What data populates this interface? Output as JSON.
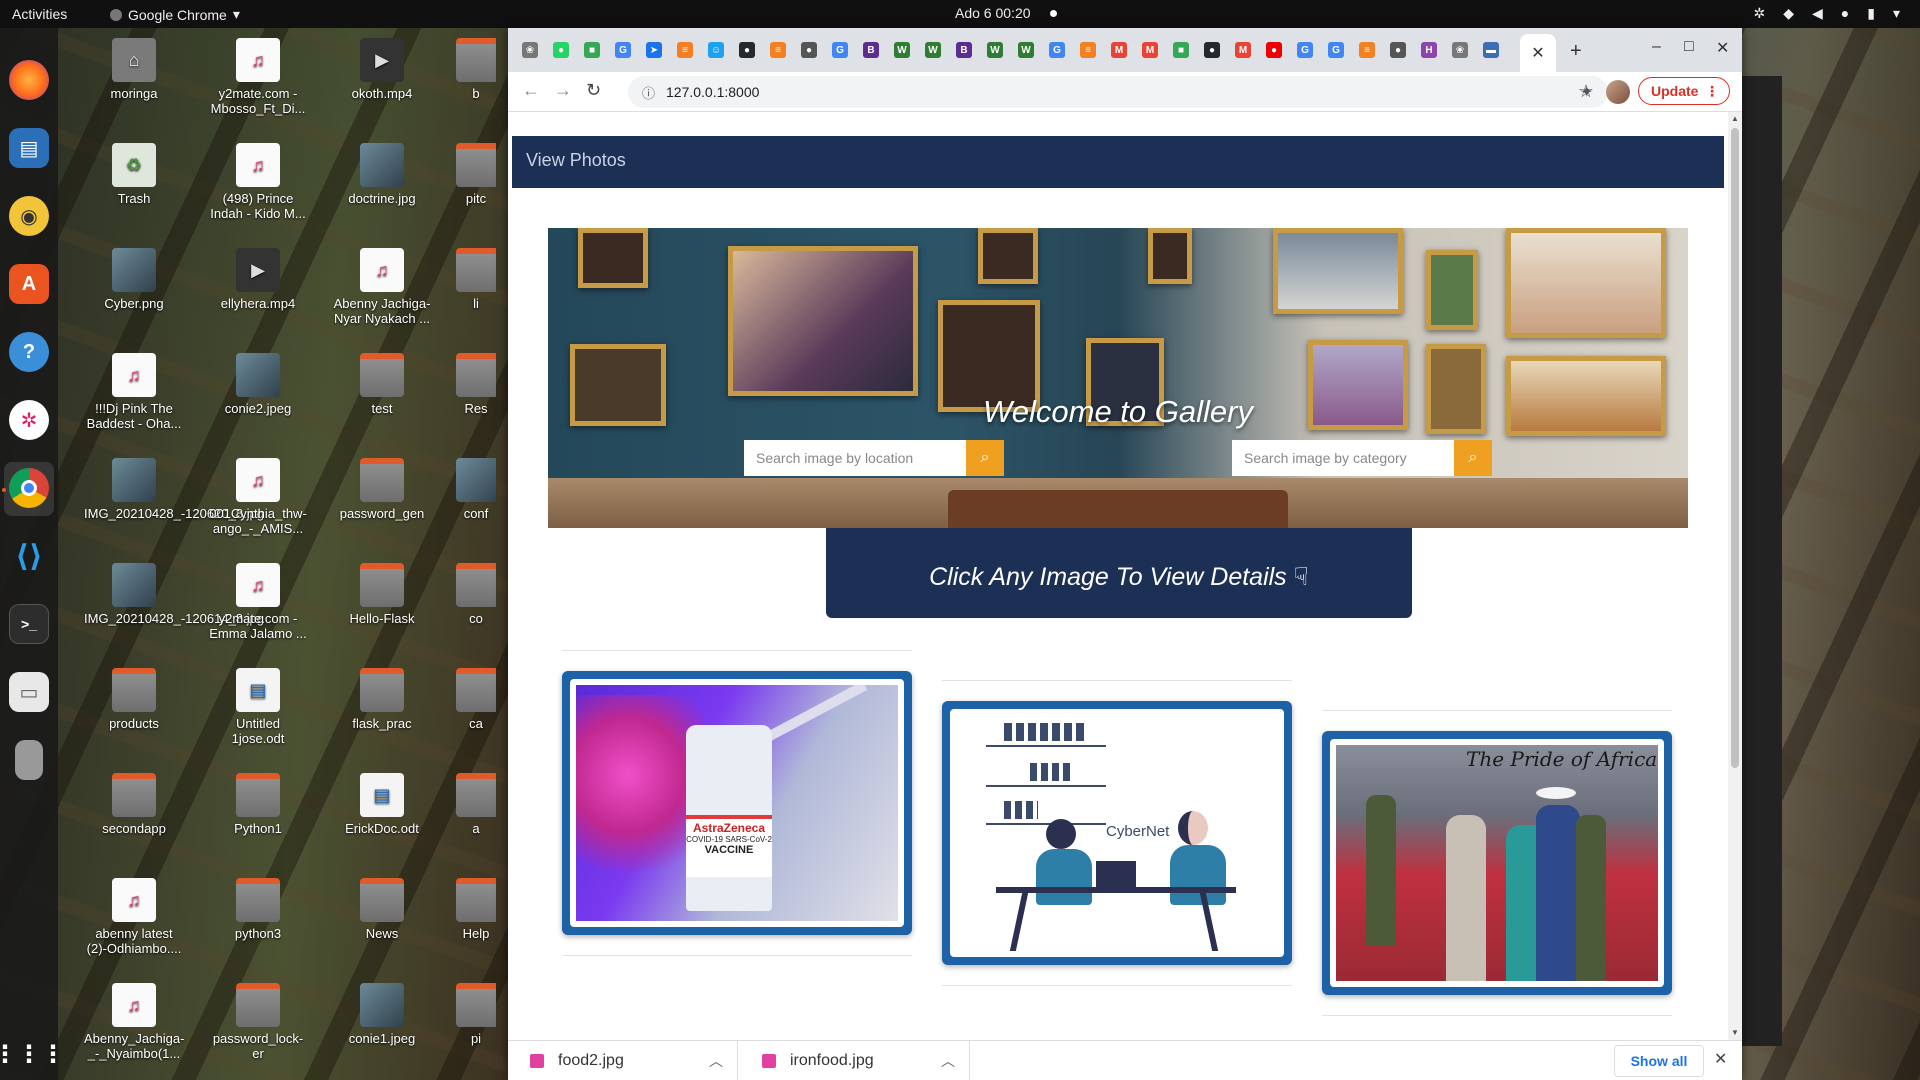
{
  "topbar": {
    "activities": "Activities",
    "app_name": "Google Chrome",
    "clock": "Ado 6  00:20"
  },
  "dock": {
    "items": [
      "firefox-icon",
      "libreoffice-writer-icon",
      "rhythmbox-icon",
      "software-center-icon",
      "help-icon",
      "slack-icon",
      "chrome-icon",
      "vscode-icon",
      "terminal-icon",
      "files-icon",
      "usb-drive-icon",
      "app-grid-icon"
    ]
  },
  "desktop": {
    "col1": [
      "moringa",
      "Trash",
      "Cyber.png",
      "!!!Dj Pink The Baddest - Oha...",
      "IMG_20210428_-120620_8.jpg",
      "IMG_20210428_-120614_8.jpg",
      "products",
      "secondapp",
      "abenny latest (2)-Odhiambo....",
      "Abenny_Jachiga-_-_Nyaimbo(1..."
    ],
    "col2": [
      "y2mate.com - Mbosso_Ft_Di...",
      "(498) Prince Indah - Kido M...",
      "ellyhera.mp4",
      "conie2.jpeg",
      "001Cynthia_thw-ango_-_AMIS...",
      "y2mate.com - Emma Jalamo ...",
      "Untitled 1jose.odt",
      "Python1",
      "python3",
      "password_lock-er"
    ],
    "col3": [
      "okoth.mp4",
      "doctrine.jpg",
      "Abenny Jachiga-Nyar Nyakach ...",
      "test",
      "password_gen",
      "Hello-Flask",
      "flask_prac",
      "ErickDoc.odt",
      "News",
      "conie1.jpeg"
    ],
    "col4": [
      "b",
      "pitc",
      "li",
      "Res",
      "conf",
      "co",
      "ca",
      "a",
      "Help",
      "pi"
    ]
  },
  "browser": {
    "url": "127.0.0.1:8000",
    "update_label": "Update",
    "tab_favicons": [
      {
        "c": "#777",
        "t": "❀"
      },
      {
        "c": "#25d366",
        "t": "●"
      },
      {
        "c": "#34a853",
        "t": "■"
      },
      {
        "c": "#4285f4",
        "t": "G"
      },
      {
        "c": "#1a73e8",
        "t": "➤"
      },
      {
        "c": "#f48024",
        "t": "≡"
      },
      {
        "c": "#1da1f2",
        "t": "☺"
      },
      {
        "c": "#24292e",
        "t": "●"
      },
      {
        "c": "#f48024",
        "t": "≡"
      },
      {
        "c": "#555",
        "t": "●"
      },
      {
        "c": "#4285f4",
        "t": "G"
      },
      {
        "c": "#5c2d91",
        "t": "B"
      },
      {
        "c": "#2e7d32",
        "t": "W"
      },
      {
        "c": "#2e7d32",
        "t": "W"
      },
      {
        "c": "#5c2d91",
        "t": "B"
      },
      {
        "c": "#2e7d32",
        "t": "W"
      },
      {
        "c": "#2e7d32",
        "t": "W"
      },
      {
        "c": "#4285f4",
        "t": "G"
      },
      {
        "c": "#f48024",
        "t": "≡"
      },
      {
        "c": "#ea4335",
        "t": "M"
      },
      {
        "c": "#ea4335",
        "t": "M"
      },
      {
        "c": "#34a853",
        "t": "■"
      },
      {
        "c": "#24292e",
        "t": "●"
      },
      {
        "c": "#ea4335",
        "t": "M"
      },
      {
        "c": "#e00",
        "t": "●"
      },
      {
        "c": "#4285f4",
        "t": "G"
      },
      {
        "c": "#4285f4",
        "t": "G"
      },
      {
        "c": "#f48024",
        "t": "≡"
      },
      {
        "c": "#555",
        "t": "●"
      },
      {
        "c": "#8e44ad",
        "t": "H"
      },
      {
        "c": "#777",
        "t": "❀"
      },
      {
        "c": "#3d6db5",
        "t": "▬"
      }
    ]
  },
  "page": {
    "nav_brand": "View Photos",
    "hero_title": "Welcome to Gallery",
    "search_location_placeholder": "Search image by location",
    "search_category_placeholder": "Search image by category",
    "cta_text": "Click Any Image To View Details",
    "cards": [
      {
        "caption": "AstraZeneca",
        "sub": "COVID-19 SARS-CoV-2",
        "sub2": "VACCINE"
      },
      {
        "caption": "CyberNet"
      },
      {
        "caption": "The Pride of Africa"
      }
    ]
  },
  "downloads": {
    "items": [
      "food2.jpg",
      "ironfood.jpg"
    ],
    "show_all": "Show all"
  },
  "colors": {
    "navy": "#1c2f55",
    "card_blue": "#1d62a6",
    "search_orange": "#f0a020",
    "update_red": "#d93025"
  }
}
